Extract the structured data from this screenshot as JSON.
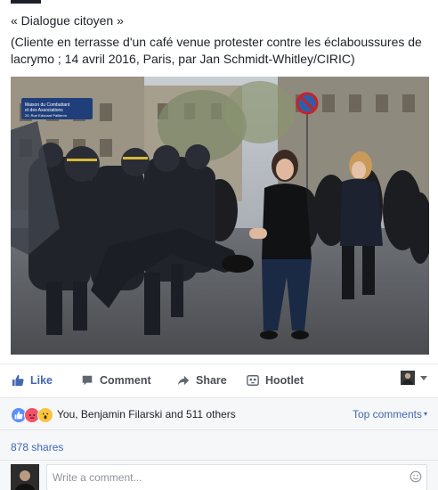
{
  "post": {
    "title": "« Dialogue citoyen »",
    "caption": "(Cliente en terrasse d'un café venue protester contre les éclaboussures de lacrymo ; 14 avril 2016, Paris, par Jan Schmidt-Whitley/CIRIC)"
  },
  "photo": {
    "street_sign_line1": "Maison du Combattant",
    "street_sign_line2": "et des Associations",
    "street_sign_line3": "20, Rue Edouard Pailleron"
  },
  "actions": {
    "like_label": "Like",
    "comment_label": "Comment",
    "share_label": "Share",
    "hootlet_label": "Hootlet"
  },
  "reactions": {
    "summary": "You, Benjamin Filarski and 511 others",
    "sort_label": "Top comments"
  },
  "shares": {
    "label": "878 shares"
  },
  "composer": {
    "placeholder": "Write a comment..."
  },
  "colors": {
    "accent": "#4267b2",
    "like_blue": "#5890ff",
    "angry": "#f25268",
    "wow": "#fcc33c",
    "text": "#1d2129",
    "muted": "#4b4f56"
  },
  "icons": {
    "like": "thumbs-up-icon",
    "comment": "speech-bubble-icon",
    "share": "share-arrow-icon",
    "hootlet": "hootlet-icon",
    "emoji": "smiley-icon",
    "caret": "caret-down-icon"
  }
}
